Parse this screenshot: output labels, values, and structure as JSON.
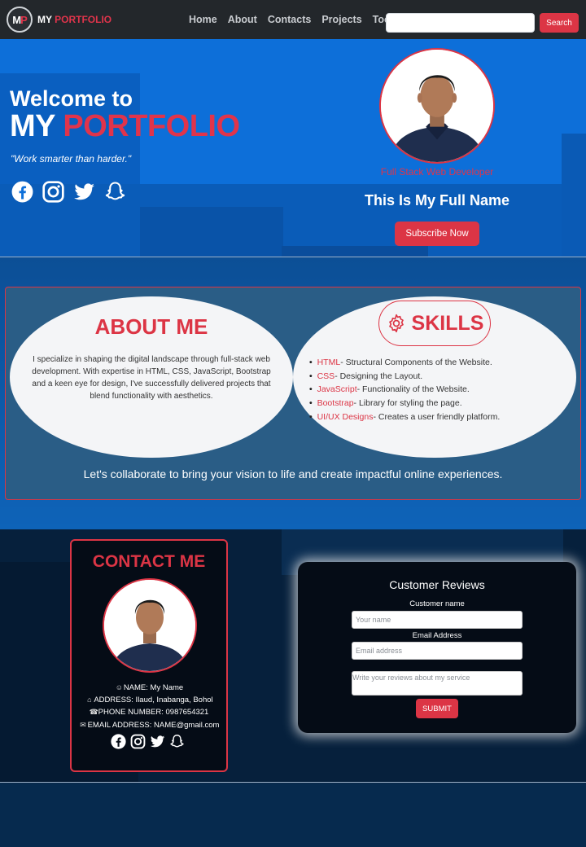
{
  "colors": {
    "accent": "#dc3545",
    "navbar": "#23272b",
    "hero_blue": "#0d6fd9"
  },
  "navbar": {
    "logo_m": "M",
    "logo_p": "P",
    "brand_white": "MY",
    "brand_red": "PORTFOLIO",
    "links": [
      "Home",
      "About",
      "Contacts",
      "Projects",
      "Tools"
    ],
    "search_placeholder": "",
    "search_button": "Search"
  },
  "hero": {
    "welcome": "Welcome to",
    "title_white": "MY",
    "title_red": "PORTFOLIO",
    "quote": "\"Work smarter than harder.\"",
    "social_icons": [
      "facebook-icon",
      "instagram-icon",
      "twitter-icon",
      "snapchat-icon"
    ],
    "role": "Full Stack Web Developer",
    "full_name": "This Is My Full Name",
    "subscribe_button": "Subscribe Now"
  },
  "about": {
    "title": "ABOUT ME",
    "text": "I specialize in shaping the digital landscape through full-stack web development. With expertise in HTML, CSS, JavaScript, Bootstrap and a keen eye for design, I've successfully delivered projects that blend functionality with aesthetics."
  },
  "skills": {
    "title": "SKILLS",
    "items": [
      {
        "name": "HTML",
        "desc": "- Structural Components of the Website."
      },
      {
        "name": "CSS",
        "desc": "- Designing the Layout."
      },
      {
        "name": "JavaScript",
        "desc": "- Functionality of the Website."
      },
      {
        "name": "Bootstrap",
        "desc": "- Library for styling the page."
      },
      {
        "name": "UI/UX Designs",
        "desc": "- Creates a user friendly platform."
      }
    ]
  },
  "collab": "Let's collaborate to bring your vision to life and create impactful online experiences.",
  "contact": {
    "title": "CONTACT ME",
    "name": "NAME: My Name",
    "address": "ADDRESS: Ilaud, Inabanga, Bohol",
    "phone": "PHONE NUMBER: 0987654321",
    "email": "EMAIL ADDRESS: NAME@gmail.com"
  },
  "reviews": {
    "title": "Customer Reviews",
    "name_label": "Customer name",
    "name_placeholder": "Your name",
    "email_label": "Email Address",
    "email_placeholder": "Email address",
    "review_placeholder": "Write your reviews about my service",
    "submit": "SUBMIT"
  }
}
